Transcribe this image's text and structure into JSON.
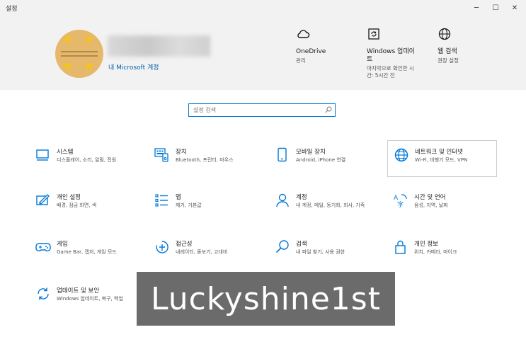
{
  "window": {
    "title": "설정",
    "minimize": "─",
    "maximize": "☐",
    "close": "✕"
  },
  "account": {
    "link_label": "내 Microsoft 계정"
  },
  "quick_links": [
    {
      "icon": "cloud-icon",
      "title": "OneDrive",
      "sub": "관리"
    },
    {
      "icon": "windows-update-icon",
      "title": "Windows 업데이트",
      "sub": "마지막으로 확인한 시간: 5시간 전"
    },
    {
      "icon": "globe-icon",
      "title": "웹 검색",
      "sub": "권장 설정"
    }
  ],
  "search": {
    "placeholder": "설정 검색"
  },
  "tiles": [
    {
      "icon": "monitor-icon",
      "name": "시스템",
      "desc": "디스플레이, 소리, 알림, 전원"
    },
    {
      "icon": "keyboard-device-icon",
      "name": "장치",
      "desc": "Bluetooth, 프린터, 마우스"
    },
    {
      "icon": "phone-icon",
      "name": "모바일 장치",
      "desc": "Android, iPhone 연결"
    },
    {
      "icon": "network-globe-icon",
      "name": "네트워크 및 인터넷",
      "desc": "Wi-Fi, 비행기 모드, VPN"
    },
    {
      "icon": "personalization-icon",
      "name": "개인 설정",
      "desc": "배경, 잠금 화면, 색"
    },
    {
      "icon": "apps-list-icon",
      "name": "앱",
      "desc": "제거, 기본값"
    },
    {
      "icon": "person-icon",
      "name": "계정",
      "desc": "내 계정, 메일, 동기화, 회사, 가족"
    },
    {
      "icon": "time-language-icon",
      "name": "시간 및 언어",
      "desc": "음성, 지역, 날짜"
    },
    {
      "icon": "gamepad-icon",
      "name": "게임",
      "desc": "Game Bar, 캡처, 게임 모드"
    },
    {
      "icon": "accessibility-icon",
      "name": "접근성",
      "desc": "내레이터, 돋보기, 고대비"
    },
    {
      "icon": "search-icon",
      "name": "검색",
      "desc": "내 파일 찾기, 사용 권한"
    },
    {
      "icon": "lock-icon",
      "name": "개인 정보",
      "desc": "위치, 카메라, 마이크"
    },
    {
      "icon": "update-security-icon",
      "name": "업데이트 및 보안",
      "desc": "Windows 업데이트, 복구, 백업"
    }
  ],
  "watermark": {
    "text": "Luckyshine1st"
  }
}
